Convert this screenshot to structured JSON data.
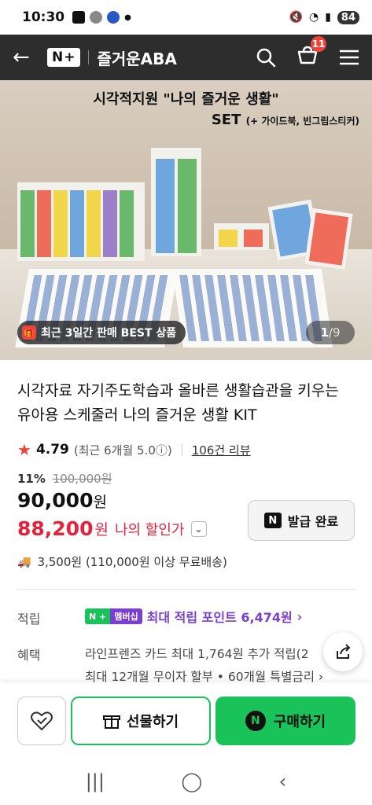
{
  "status": {
    "time": "10:30",
    "battery": "84"
  },
  "header": {
    "brand_badge": "N+",
    "title": "즐거운ABA",
    "cart_count": "11"
  },
  "hero": {
    "line1": "시각적지원 \"나의 즐거운 생활\"",
    "line2": "SET",
    "line2_small": "(+ 가이드북, 빈그림스티커)",
    "badge_text": "최근 3일간 판매 BEST 상품",
    "page_current": "1",
    "page_total": "/9"
  },
  "product": {
    "title": "시각자료 자기주도학습과 올바른 생활습관을 키우는 유아용 스케줄러 나의 즐거운 생활 KIT",
    "rating": "4.79",
    "rating_sub": "(최근 6개월 5.0ⓘ)",
    "reviews": "106건 리뷰",
    "discount_rate": "11%",
    "original_price": "100,000원",
    "price": "90,000",
    "price_unit": "원",
    "my_price": "88,200",
    "my_price_unit": "원",
    "my_price_label": "나의 할인가",
    "coupon_label": "발급 완료",
    "shipping": "3,500원 (110,000원 이상 무료배송)"
  },
  "points": {
    "label": "적립",
    "badge_n": "N +",
    "badge_member": "멤버십",
    "text": "최대 적립 포인트 6,474원"
  },
  "benefit": {
    "label": "혜택",
    "line1": "라인프렌즈 카드 최대 1,764원 추가 적립(2",
    "line2": "최대 12개월 무이자 할부 • 60개월 특별금리"
  },
  "actions": {
    "gift_label": "선물하기",
    "buy_label": "구매하기"
  },
  "colors": {
    "accent_green": "#19c35a",
    "sale_red": "#e4223a",
    "point_purple": "#7a3fd0"
  }
}
